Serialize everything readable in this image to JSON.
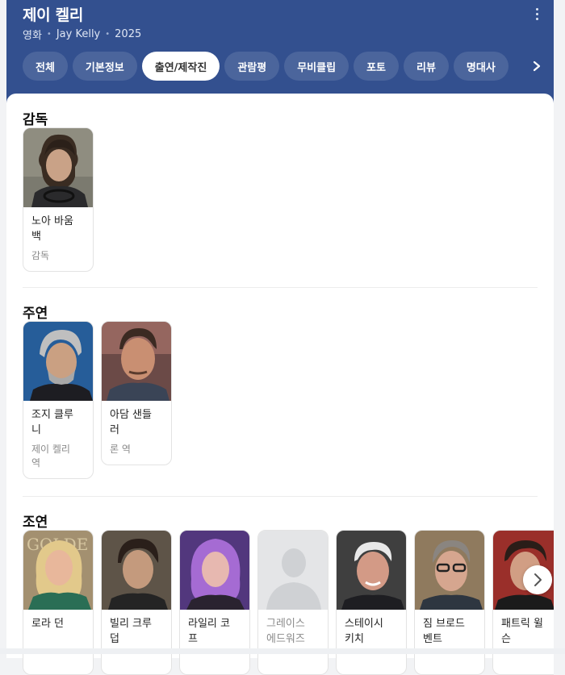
{
  "header": {
    "title": "제이 켈리",
    "meta": [
      "영화",
      "Jay Kelly",
      "2025"
    ]
  },
  "tabs": [
    "전체",
    "기본정보",
    "출연/제작진",
    "관람평",
    "무비클립",
    "포토",
    "리뷰",
    "명대사"
  ],
  "active_tab": "출연/제작진",
  "sections": {
    "director": {
      "title": "감독",
      "people": [
        {
          "name": "노아 바움\n백",
          "role": "감독"
        }
      ]
    },
    "lead": {
      "title": "주연",
      "people": [
        {
          "name": "조지 클루\n니",
          "role": "제이 켈리\n역"
        },
        {
          "name": "아담 샌들\n러",
          "role": "론 역"
        }
      ]
    },
    "supporting": {
      "title": "조연",
      "people": [
        {
          "name": "로라 던",
          "role": ""
        },
        {
          "name": "빌리 크루\n덥",
          "role": ""
        },
        {
          "name": "라일리 코\n프",
          "role": ""
        },
        {
          "name": "그레이스\n에드워즈",
          "role": ""
        },
        {
          "name": "스테이시\n키치",
          "role": ""
        },
        {
          "name": "짐 브로드\n벤트",
          "role": ""
        },
        {
          "name": "패트릭 윌\n슨",
          "role": ""
        }
      ]
    }
  },
  "colors": {
    "header_bg": "#33508f",
    "panel_bg": "#ffffff"
  }
}
